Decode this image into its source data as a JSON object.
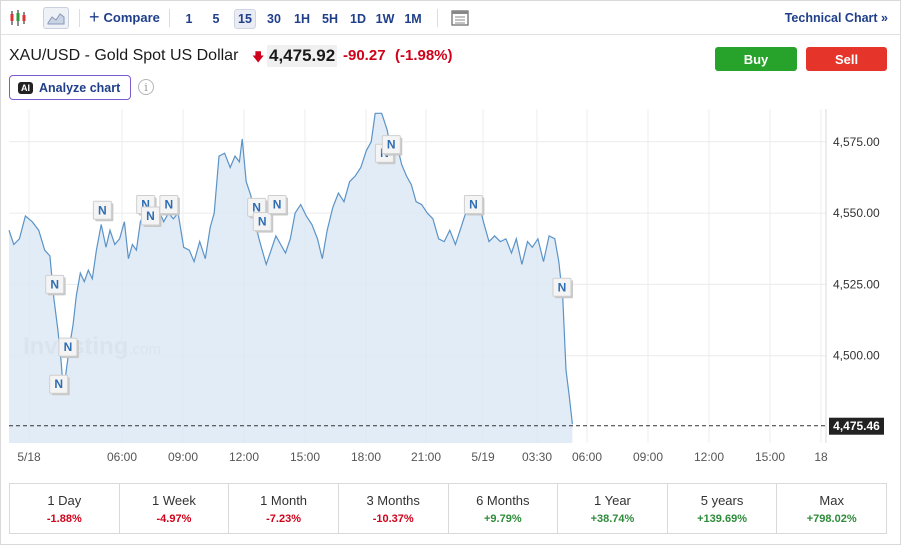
{
  "toolbar": {
    "compare_label": "Compare",
    "timeframes": [
      "1",
      "5",
      "15",
      "30",
      "1H",
      "5H",
      "1D",
      "1W",
      "1M"
    ],
    "active_timeframe": "15",
    "technical_chart_label": "Technical Chart »"
  },
  "header": {
    "title": "XAU/USD - Gold Spot US Dollar",
    "price": "4,475.92",
    "change": "-90.27",
    "change_pct": "(-1.98%)",
    "buy_label": "Buy",
    "sell_label": "Sell",
    "ai_badge": "AI",
    "analyze_label": "Analyze chart",
    "info_glyph": "i"
  },
  "colors": {
    "line": "#5b93c7",
    "area": "#dde9f4",
    "negative": "#d0021b",
    "positive": "#2e8b3a",
    "buy": "#27a22a",
    "sell": "#e5342a",
    "brand": "#1f3f8a"
  },
  "chart_data": {
    "type": "area",
    "x_labels": [
      "5/18",
      "06:00",
      "09:00",
      "12:00",
      "15:00",
      "18:00",
      "21:00",
      "5/19",
      "03:30",
      "06:00",
      "09:00",
      "12:00",
      "15:00",
      "18"
    ],
    "y_ticks": [
      "4,575.00",
      "4,550.00",
      "4,525.00",
      "4,500.00"
    ],
    "y_tick_values": [
      4575,
      4550,
      4525,
      4500
    ],
    "ylim": [
      4469.4,
      4586.5
    ],
    "current_price_label": "4,475.46",
    "current_price": 4475.46,
    "watermark": "Investing.com",
    "news_marker_label": "N",
    "news_markers": [
      {
        "x": 0.114,
        "y": 4525
      },
      {
        "x": 0.147,
        "y": 4503
      },
      {
        "x": 0.124,
        "y": 4490
      },
      {
        "x": 0.233,
        "y": 4551
      },
      {
        "x": 0.341,
        "y": 4553
      },
      {
        "x": 0.353,
        "y": 4549
      },
      {
        "x": 0.399,
        "y": 4553
      },
      {
        "x": 0.618,
        "y": 4552
      },
      {
        "x": 0.632,
        "y": 4547
      },
      {
        "x": 0.669,
        "y": 4553
      },
      {
        "x": 0.937,
        "y": 4571
      },
      {
        "x": 0.954,
        "y": 4574
      },
      {
        "x": 1.159,
        "y": 4553
      },
      {
        "x": 1.38,
        "y": 4524
      }
    ],
    "series": [
      {
        "x": 0.0,
        "y": 4544
      },
      {
        "x": 0.012,
        "y": 4539
      },
      {
        "x": 0.026,
        "y": 4541
      },
      {
        "x": 0.041,
        "y": 4549
      },
      {
        "x": 0.058,
        "y": 4547
      },
      {
        "x": 0.074,
        "y": 4544
      },
      {
        "x": 0.089,
        "y": 4537
      },
      {
        "x": 0.102,
        "y": 4535
      },
      {
        "x": 0.112,
        "y": 4520
      },
      {
        "x": 0.122,
        "y": 4509
      },
      {
        "x": 0.13,
        "y": 4498
      },
      {
        "x": 0.136,
        "y": 4487
      },
      {
        "x": 0.144,
        "y": 4496
      },
      {
        "x": 0.152,
        "y": 4504
      },
      {
        "x": 0.16,
        "y": 4511
      },
      {
        "x": 0.168,
        "y": 4521
      },
      {
        "x": 0.178,
        "y": 4529
      },
      {
        "x": 0.188,
        "y": 4526
      },
      {
        "x": 0.198,
        "y": 4530
      },
      {
        "x": 0.208,
        "y": 4527
      },
      {
        "x": 0.218,
        "y": 4537
      },
      {
        "x": 0.23,
        "y": 4546
      },
      {
        "x": 0.242,
        "y": 4538
      },
      {
        "x": 0.252,
        "y": 4544
      },
      {
        "x": 0.264,
        "y": 4539
      },
      {
        "x": 0.276,
        "y": 4541
      },
      {
        "x": 0.288,
        "y": 4547
      },
      {
        "x": 0.298,
        "y": 4534
      },
      {
        "x": 0.308,
        "y": 4539
      },
      {
        "x": 0.318,
        "y": 4537
      },
      {
        "x": 0.328,
        "y": 4547
      },
      {
        "x": 0.338,
        "y": 4550
      },
      {
        "x": 0.35,
        "y": 4548
      },
      {
        "x": 0.362,
        "y": 4549
      },
      {
        "x": 0.374,
        "y": 4551
      },
      {
        "x": 0.386,
        "y": 4547
      },
      {
        "x": 0.398,
        "y": 4550
      },
      {
        "x": 0.41,
        "y": 4548
      },
      {
        "x": 0.422,
        "y": 4550
      },
      {
        "x": 0.436,
        "y": 4538
      },
      {
        "x": 0.45,
        "y": 4537
      },
      {
        "x": 0.462,
        "y": 4533
      },
      {
        "x": 0.476,
        "y": 4540
      },
      {
        "x": 0.49,
        "y": 4534
      },
      {
        "x": 0.502,
        "y": 4545
      },
      {
        "x": 0.512,
        "y": 4550
      },
      {
        "x": 0.524,
        "y": 4570
      },
      {
        "x": 0.538,
        "y": 4571
      },
      {
        "x": 0.552,
        "y": 4566
      },
      {
        "x": 0.564,
        "y": 4570
      },
      {
        "x": 0.575,
        "y": 4568
      },
      {
        "x": 0.582,
        "y": 4576
      },
      {
        "x": 0.592,
        "y": 4561
      },
      {
        "x": 0.604,
        "y": 4556
      },
      {
        "x": 0.614,
        "y": 4547
      },
      {
        "x": 0.624,
        "y": 4541
      },
      {
        "x": 0.632,
        "y": 4537
      },
      {
        "x": 0.642,
        "y": 4532
      },
      {
        "x": 0.654,
        "y": 4537
      },
      {
        "x": 0.666,
        "y": 4542
      },
      {
        "x": 0.678,
        "y": 4539
      },
      {
        "x": 0.69,
        "y": 4536
      },
      {
        "x": 0.702,
        "y": 4541
      },
      {
        "x": 0.714,
        "y": 4550
      },
      {
        "x": 0.728,
        "y": 4553
      },
      {
        "x": 0.742,
        "y": 4549
      },
      {
        "x": 0.756,
        "y": 4546
      },
      {
        "x": 0.77,
        "y": 4541
      },
      {
        "x": 0.782,
        "y": 4534
      },
      {
        "x": 0.794,
        "y": 4544
      },
      {
        "x": 0.808,
        "y": 4552
      },
      {
        "x": 0.822,
        "y": 4557
      },
      {
        "x": 0.836,
        "y": 4554
      },
      {
        "x": 0.85,
        "y": 4561
      },
      {
        "x": 0.864,
        "y": 4563
      },
      {
        "x": 0.878,
        "y": 4566
      },
      {
        "x": 0.892,
        "y": 4572
      },
      {
        "x": 0.904,
        "y": 4575
      },
      {
        "x": 0.914,
        "y": 4585
      },
      {
        "x": 0.93,
        "y": 4585
      },
      {
        "x": 0.944,
        "y": 4579
      },
      {
        "x": 0.956,
        "y": 4569
      },
      {
        "x": 0.968,
        "y": 4574
      },
      {
        "x": 0.98,
        "y": 4567
      },
      {
        "x": 0.992,
        "y": 4563
      },
      {
        "x": 1.004,
        "y": 4560
      },
      {
        "x": 1.016,
        "y": 4554
      },
      {
        "x": 1.03,
        "y": 4553
      },
      {
        "x": 1.044,
        "y": 4550
      },
      {
        "x": 1.058,
        "y": 4548
      },
      {
        "x": 1.072,
        "y": 4541
      },
      {
        "x": 1.086,
        "y": 4540
      },
      {
        "x": 1.1,
        "y": 4544
      },
      {
        "x": 1.114,
        "y": 4539
      },
      {
        "x": 1.128,
        "y": 4545
      },
      {
        "x": 1.142,
        "y": 4551
      },
      {
        "x": 1.156,
        "y": 4552
      },
      {
        "x": 1.17,
        "y": 4555
      },
      {
        "x": 1.184,
        "y": 4547
      },
      {
        "x": 1.198,
        "y": 4540
      },
      {
        "x": 1.212,
        "y": 4542
      },
      {
        "x": 1.226,
        "y": 4540
      },
      {
        "x": 1.24,
        "y": 4541
      },
      {
        "x": 1.254,
        "y": 4536
      },
      {
        "x": 1.266,
        "y": 4541
      },
      {
        "x": 1.28,
        "y": 4532
      },
      {
        "x": 1.294,
        "y": 4540
      },
      {
        "x": 1.306,
        "y": 4538
      },
      {
        "x": 1.32,
        "y": 4541
      },
      {
        "x": 1.334,
        "y": 4533
      },
      {
        "x": 1.348,
        "y": 4542
      },
      {
        "x": 1.362,
        "y": 4541
      },
      {
        "x": 1.372,
        "y": 4533
      },
      {
        "x": 1.382,
        "y": 4520
      },
      {
        "x": 1.39,
        "y": 4495
      },
      {
        "x": 1.398,
        "y": 4486
      },
      {
        "x": 1.406,
        "y": 4476
      }
    ],
    "x_unit": "days since 5/18 00:00"
  },
  "periods": [
    {
      "label": "1 Day",
      "value": "-1.88%",
      "sign": "neg"
    },
    {
      "label": "1 Week",
      "value": "-4.97%",
      "sign": "neg"
    },
    {
      "label": "1 Month",
      "value": "-7.23%",
      "sign": "neg"
    },
    {
      "label": "3 Months",
      "value": "-10.37%",
      "sign": "neg"
    },
    {
      "label": "6 Months",
      "value": "+9.79%",
      "sign": "pos"
    },
    {
      "label": "1 Year",
      "value": "+38.74%",
      "sign": "pos"
    },
    {
      "label": "5 years",
      "value": "+139.69%",
      "sign": "pos"
    },
    {
      "label": "Max",
      "value": "+798.02%",
      "sign": "pos"
    }
  ]
}
